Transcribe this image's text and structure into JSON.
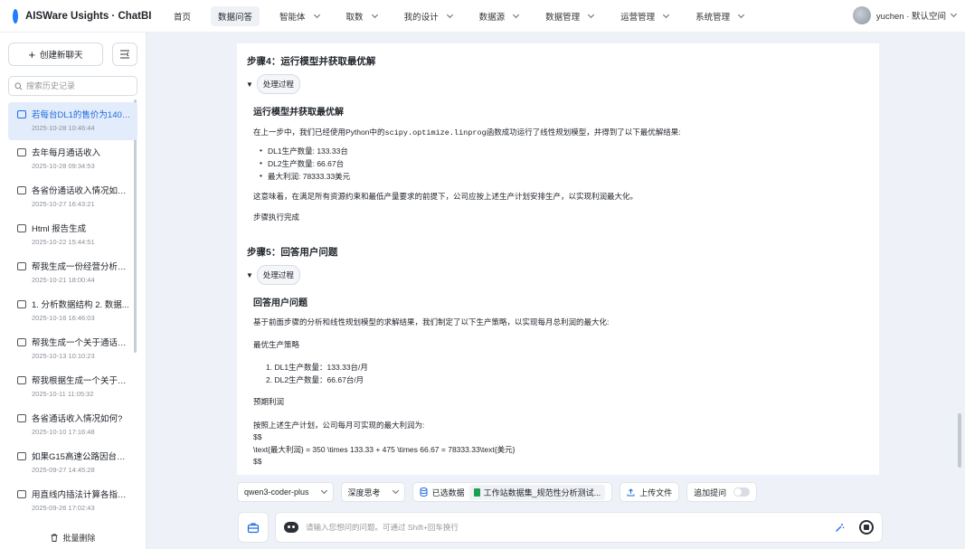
{
  "app": {
    "title": "AISWare Usights · ChatBI"
  },
  "nav": [
    {
      "label": "首页",
      "active": false,
      "dropdown": false
    },
    {
      "label": "数据问答",
      "active": true,
      "dropdown": false
    },
    {
      "label": "智能体",
      "active": false,
      "dropdown": true
    },
    {
      "label": "取数",
      "active": false,
      "dropdown": true
    },
    {
      "label": "我的设计",
      "active": false,
      "dropdown": true
    },
    {
      "label": "数据源",
      "active": false,
      "dropdown": true
    },
    {
      "label": "数据管理",
      "active": false,
      "dropdown": true
    },
    {
      "label": "运营管理",
      "active": false,
      "dropdown": true
    },
    {
      "label": "系统管理",
      "active": false,
      "dropdown": true
    }
  ],
  "user": {
    "name": "yuchen · 默认空间"
  },
  "sidebar": {
    "new_chat": "创建新聊天",
    "search_placeholder": "搜索历史记录",
    "batch_delete": "批量删除",
    "history": [
      {
        "title": "若每台DL1的售价为1400...",
        "time": "2025-10-28 10:46:44",
        "active": true
      },
      {
        "title": "去年每月通话收入",
        "time": "2025-10-28 09:34:53",
        "active": false
      },
      {
        "title": "各省份通话收入情况如何...",
        "time": "2025-10-27 16:43:21",
        "active": false
      },
      {
        "title": "Html 报告生成",
        "time": "2025-10-22 15:44:51",
        "active": false
      },
      {
        "title": "帮我生成一份经营分析报告",
        "time": "2025-10-21 18:00:44",
        "active": false
      },
      {
        "title": "1. 分析数据结构 2. 数据...",
        "time": "2025-10-16 16:46:03",
        "active": false
      },
      {
        "title": "帮我生成一个关于通话收...",
        "time": "2025-10-13 10:10:23",
        "active": false
      },
      {
        "title": "帮我根据生成一个关于通...",
        "time": "2025-10-11 11:05:32",
        "active": false
      },
      {
        "title": "各省通话收入情况如何?",
        "time": "2025-10-10 17:16:48",
        "active": false
      },
      {
        "title": "如果G15高速公路因台风...",
        "time": "2025-09-27 14:45:28",
        "active": false
      },
      {
        "title": "用直线内插法计算各指标...",
        "time": "2025-09-26 17:02:43",
        "active": false
      }
    ]
  },
  "content": {
    "step4": {
      "title": "步骤4：运行模型并获取最优解",
      "process_label": "处理过程",
      "heading": "运行模型并获取最优解",
      "intro_before": "在上一步中，我们已经使用Python中的",
      "intro_code": "scipy.optimize.linprog",
      "intro_after": "函数成功运行了线性规划模型，并得到了以下最优解结果:",
      "bullets": [
        "DL1生产数量: 133.33台",
        "DL2生产数量: 66.67台",
        "最大利润: 78333.33美元"
      ],
      "summary": "这意味着，在满足所有资源约束和最低产量要求的前提下，公司应按上述生产计划安排生产，以实现利润最大化。",
      "done": "步骤执行完成"
    },
    "step5": {
      "title": "步骤5：回答用户问题",
      "process_label": "处理过程",
      "heading": "回答用户问题",
      "intro": "基于前面步骤的分析和线性规划模型的求解结果，我们制定了以下生产策略，以实现每月总利润的最大化:",
      "strategy_heading": "最优生产策略",
      "items": [
        "DL1生产数量：133.33台/月",
        "DL2生产数量：66.67台/月"
      ],
      "profit_heading": "预期利润",
      "profit_intro": "按照上述生产计划，公司每月可实现的最大利润为:",
      "math_open": "$$",
      "math_line": "\\text{最大利润} = 350 \\times 133.33 + 475 \\times 66.67 = 78333.33\\text{美元}",
      "math_close": "$$"
    }
  },
  "toolbar": {
    "model": "qwen3-coder-plus",
    "think": "深度思考",
    "selected_data_label": "已选数据",
    "dataset": "工作站数据集_规范性分析测试...",
    "upload": "上传文件",
    "followup": "追加提问"
  },
  "input": {
    "placeholder": "请输入您想问的问题。可通过 Shift+回车换行"
  }
}
